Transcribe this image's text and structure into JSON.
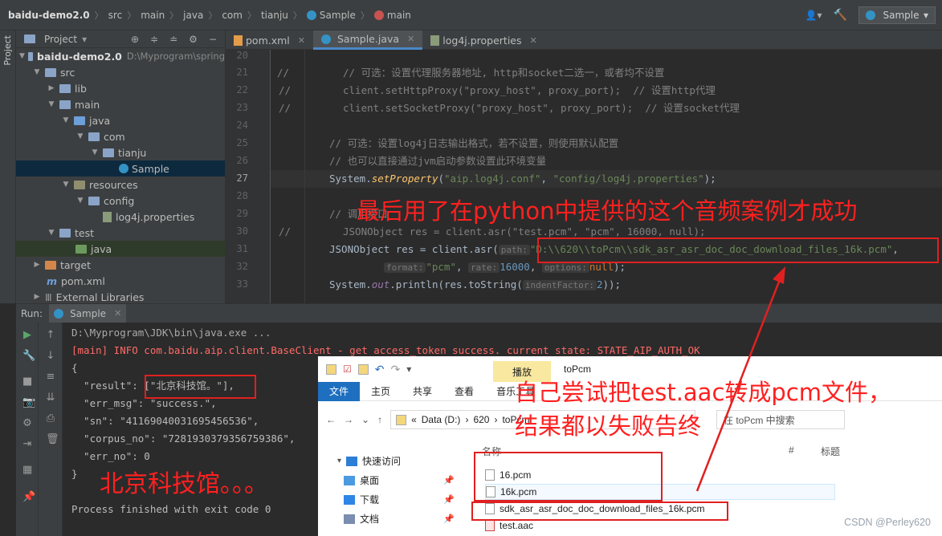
{
  "navbar": {
    "crumbs": [
      "baidu-demo2.0",
      "src",
      "main",
      "java",
      "com",
      "tianju",
      "Sample",
      "main"
    ],
    "run_config": "Sample"
  },
  "left_stripe": {
    "label": "Project"
  },
  "project": {
    "header": "Project",
    "tree": [
      {
        "label": "baidu-demo2.0",
        "extra": "D:\\Myprogram\\spring"
      },
      {
        "label": "src"
      },
      {
        "label": "lib"
      },
      {
        "label": "main"
      },
      {
        "label": "java"
      },
      {
        "label": "com"
      },
      {
        "label": "tianju"
      },
      {
        "label": "Sample"
      },
      {
        "label": "resources"
      },
      {
        "label": "config"
      },
      {
        "label": "log4j.properties"
      },
      {
        "label": "test"
      },
      {
        "label": "java"
      },
      {
        "label": "target"
      },
      {
        "label": "pom.xml"
      },
      {
        "label": "External Libraries"
      }
    ]
  },
  "editor": {
    "tabs": [
      "pom.xml",
      "Sample.java",
      "log4j.properties"
    ],
    "active_tab": "Sample.java",
    "line_numbers": [
      "20",
      "21",
      "22",
      "23",
      "24",
      "25",
      "26",
      "27",
      "28",
      "29",
      "30",
      "31",
      "32",
      "33",
      "34"
    ],
    "lines": {
      "l21_cm": "//",
      "l21": "// 可选：设置代理服务器地址, http和socket二选一，或者均不设置",
      "l22_cm": "//",
      "l22a": "client.setHttpProxy(",
      "l22b": "\"proxy_host\"",
      "l22c": ", proxy_port);  ",
      "l22d": "// 设置http代理",
      "l23_cm": "//",
      "l23a": "client.setSocketProxy(",
      "l23b": "\"proxy_host\"",
      "l23c": ", proxy_port);  ",
      "l23d": "// 设置socket代理",
      "l25": "// 可选：设置log4j日志输出格式，若不设置，则使用默认配置",
      "l26": "// 也可以直接通过jvm启动参数设置此环境变量",
      "l27a": "System.",
      "l27b": "setProperty",
      "l27c": "(",
      "l27d": "\"aip.log4j.conf\"",
      "l27e": ", ",
      "l27f": "\"config/log4j.properties\"",
      "l27g": ");",
      "l29": "// 调用接口",
      "l30_cm": "//",
      "l30": "JSONObject res = client.asr(\"test.pcm\", \"pcm\", 16000, null);",
      "l31a": "JSONObject res = client.asr(",
      "l31_hint": "path:",
      "l31b": "\"D:\\\\620\\\\toPcm\\\\sdk_asr_asr_doc_doc_download_files_16k.pcm\"",
      "l31c": ",",
      "l32_hint1": "format:",
      "l32a": "\"pcm\"",
      "l32b": ", ",
      "l32_hint2": "rate:",
      "l32c": "16000",
      "l32d": ", ",
      "l32_hint3": "options:",
      "l32e": "null",
      "l32f": ");",
      "l33a": "System.",
      "l33b": "out",
      "l33c": ".println(res.toString(",
      "l33_hint": "indentFactor:",
      "l33d": "2",
      "l33e": "));"
    }
  },
  "run": {
    "label": "Run:",
    "tab": "Sample",
    "console": [
      "D:\\Myprogram\\JDK\\bin\\java.exe ...",
      "[main] INFO com.baidu.aip.client.BaseClient - get access_token success. current state: STATE_AIP_AUTH_OK",
      "{",
      "  \"result\": [\"北京科技馆。\"],",
      "  \"err_msg\": \"success.\",",
      "  \"sn\": \"41169040031695456536\",",
      "  \"corpus_no\": \"7281930379356759386\",",
      "  \"err_no\": 0",
      "}",
      "",
      "Process finished with exit code 0"
    ]
  },
  "explorer": {
    "play_tab": "播放",
    "folder_title": "toPcm",
    "ribbon": [
      "文件",
      "主页",
      "共享",
      "查看",
      "音乐工具"
    ],
    "address": [
      "Data (D:)",
      "620",
      "toPcm"
    ],
    "search_placeholder": "在 toPcm 中搜索",
    "nav": [
      "快速访问",
      "桌面",
      "下载",
      "文档"
    ],
    "columns": [
      "名称",
      "#",
      "标题"
    ],
    "files": [
      "16.pcm",
      "16k.pcm",
      "sdk_asr_asr_doc_doc_download_files_16k.pcm",
      "test.aac"
    ]
  },
  "annotations": {
    "top": "最后用了在python中提供的这个音频案例才成功",
    "result": "北京科技馆。。。",
    "explorer_line1": "自己尝试把test.aac转成pcm文件，",
    "explorer_line2": "结果都以失败告终",
    "color": "#ff2020"
  },
  "watermark": "CSDN @Perley620"
}
